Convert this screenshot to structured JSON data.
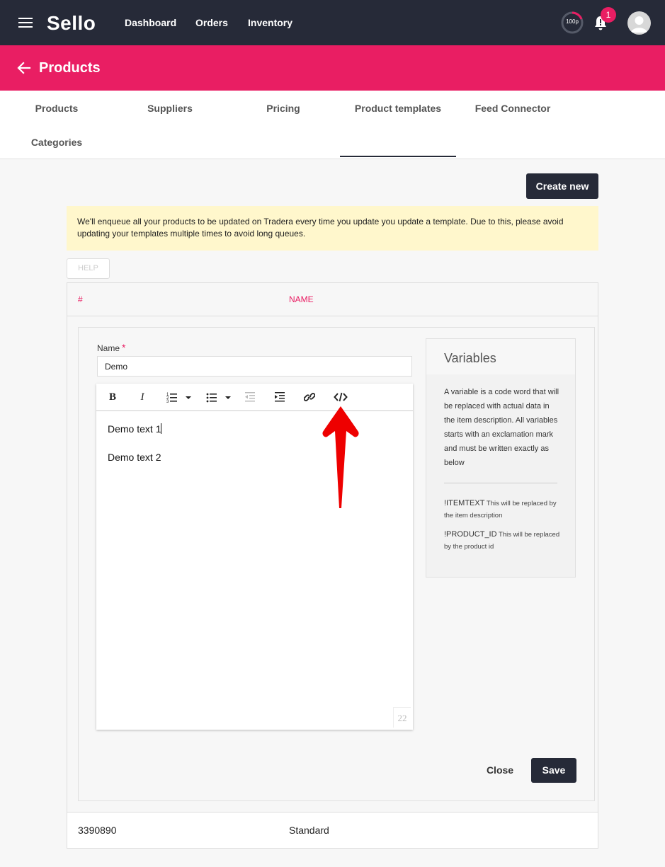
{
  "app": {
    "name": "Sello"
  },
  "topnav": {
    "items": [
      {
        "label": "Dashboard"
      },
      {
        "label": "Orders"
      },
      {
        "label": "Inventory"
      }
    ],
    "gauge_label": "100p",
    "notification_count": "1"
  },
  "header": {
    "title": "Products"
  },
  "tabs": [
    {
      "label": "Products"
    },
    {
      "label": "Suppliers"
    },
    {
      "label": "Pricing"
    },
    {
      "label": "Product templates",
      "active": true
    },
    {
      "label": "Feed Connector"
    },
    {
      "label": "Categories"
    }
  ],
  "actions": {
    "create_new": "Create new",
    "help": "HELP"
  },
  "notice": "We'll enqueue all your products to be updated on Tradera every time you update you update a template. Due to this, please avoid updating your templates multiple times to avoid long queues.",
  "table": {
    "headers": {
      "id": "#",
      "name": "NAME"
    },
    "rows": [
      {
        "id": "3390890",
        "name": "Standard"
      }
    ]
  },
  "editor_form": {
    "name_label": "Name",
    "required_mark": "*",
    "name_value": "Demo",
    "content": [
      "Demo text 1",
      "Demo text 2"
    ],
    "char_count": "22",
    "toolbar": [
      "bold",
      "italic",
      "ordered-list",
      "unordered-list",
      "outdent",
      "indent",
      "link",
      "code-view"
    ],
    "close_label": "Close",
    "save_label": "Save"
  },
  "variables": {
    "title": "Variables",
    "description": "A variable is a code word that will be replaced with actual data in the item description. All variables starts with an exclamation mark and must be written exactly as below",
    "items": [
      {
        "name": "!ITEMTEXT",
        "description": "This will be replaced by the item description"
      },
      {
        "name": "!PRODUCT_ID",
        "description": "This will be replaced by the product id"
      }
    ]
  },
  "colors": {
    "nav": "#262a38",
    "accent": "#e91e63",
    "notice": "#fff7cc",
    "annotation_arrow": "#ee0000"
  }
}
